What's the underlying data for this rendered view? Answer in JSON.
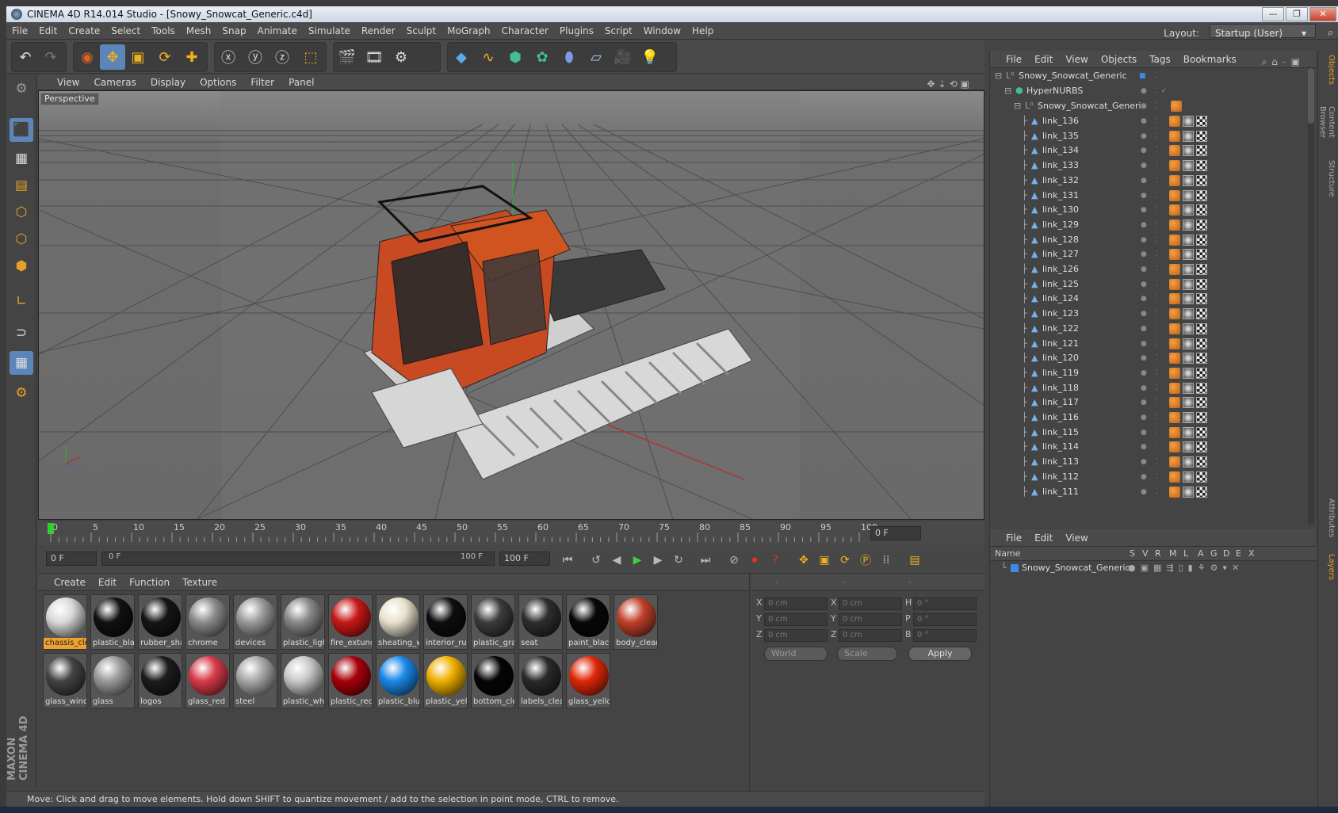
{
  "window": {
    "title": "CINEMA 4D R14.014 Studio - [Snowy_Snowcat_Generic.c4d]",
    "minimize": "—",
    "maximize": "❐",
    "close": "✕"
  },
  "menu": [
    "File",
    "Edit",
    "Create",
    "Select",
    "Tools",
    "Mesh",
    "Snap",
    "Animate",
    "Simulate",
    "Render",
    "Sculpt",
    "MoGraph",
    "Character",
    "Plugins",
    "Script",
    "Window",
    "Help"
  ],
  "layout": {
    "label": "Layout:",
    "value": "Startup (User)"
  },
  "viewport": {
    "menu": [
      "View",
      "Cameras",
      "Display",
      "Options",
      "Filter",
      "Panel"
    ],
    "label": "Perspective"
  },
  "timeline": {
    "ticks": [
      "0",
      "5",
      "10",
      "15",
      "20",
      "25",
      "30",
      "35",
      "40",
      "45",
      "50",
      "55",
      "60",
      "65",
      "70",
      "75",
      "80",
      "85",
      "90",
      "95",
      "100"
    ],
    "current_frame": "0 F"
  },
  "playback": {
    "start": "0 F",
    "range_start": "0 F",
    "range_end": "100 F",
    "end": "100 F"
  },
  "materials": {
    "menu": [
      "Create",
      "Edit",
      "Function",
      "Texture"
    ],
    "items": [
      {
        "name": "chassis_cle",
        "color": "#d8d8d8",
        "selected": true
      },
      {
        "name": "plastic_blac",
        "color": "#111111"
      },
      {
        "name": "rubber_sha",
        "color": "#151515"
      },
      {
        "name": "chrome",
        "color": "#8a8a8a"
      },
      {
        "name": "devices",
        "color": "#9a9a9a"
      },
      {
        "name": "plastic_ligh",
        "color": "#888888"
      },
      {
        "name": "fire_extung",
        "color": "#c81818"
      },
      {
        "name": "sheating_w",
        "color": "#e8e2cc"
      },
      {
        "name": "interior_rul",
        "color": "#0e0e0e"
      },
      {
        "name": "plastic_gra",
        "color": "#3c3c3c"
      },
      {
        "name": "seat",
        "color": "#2e2e2e"
      },
      {
        "name": "paint_black",
        "color": "#080808"
      },
      {
        "name": "body_clear",
        "color": "#c0402a"
      },
      {
        "name": "glass_wind",
        "color": "#444444"
      },
      {
        "name": "glass",
        "color": "#9a9a9a"
      },
      {
        "name": "logos",
        "color": "#1c1c1c"
      },
      {
        "name": "glass_red",
        "color": "#d83a4a"
      },
      {
        "name": "steel",
        "color": "#a8a8a8"
      },
      {
        "name": "plastic_whi",
        "color": "#c8c8c8"
      },
      {
        "name": "plastic_red",
        "color": "#a8000a"
      },
      {
        "name": "plastic_blu",
        "color": "#1a88e8"
      },
      {
        "name": "plastic_yell",
        "color": "#f0b000"
      },
      {
        "name": "bottom_cle",
        "color": "#050505"
      },
      {
        "name": "labels_clea",
        "color": "#2a2a2a"
      },
      {
        "name": "glass_yello",
        "color": "#e02808"
      }
    ]
  },
  "coords": {
    "headers": [
      "--",
      "--",
      "--"
    ],
    "rows": [
      {
        "l1": "X",
        "v1": "0 cm",
        "l2": "X",
        "v2": "0 cm",
        "l3": "H",
        "v3": "0 °"
      },
      {
        "l1": "Y",
        "v1": "0 cm",
        "l2": "Y",
        "v2": "0 cm",
        "l3": "P",
        "v3": "0 °"
      },
      {
        "l1": "Z",
        "v1": "0 cm",
        "l2": "Z",
        "v2": "0 cm",
        "l3": "B",
        "v3": "0 °"
      }
    ],
    "mode1": "World",
    "mode2": "Scale",
    "apply": "Apply"
  },
  "status": "Move: Click and drag to move elements. Hold down SHIFT to quantize movement / add to the selection in point mode, CTRL to remove.",
  "objects": {
    "menu": [
      "File",
      "Edit",
      "View",
      "Objects",
      "Tags",
      "Bookmarks"
    ],
    "root": "Snowy_Snowcat_Generic",
    "hypernurbs": "HyperNURBS",
    "group": "Snowy_Snowcat_Generic",
    "links": [
      "link_136",
      "link_135",
      "link_134",
      "link_133",
      "link_132",
      "link_131",
      "link_130",
      "link_129",
      "link_128",
      "link_127",
      "link_126",
      "link_125",
      "link_124",
      "link_123",
      "link_122",
      "link_121",
      "link_120",
      "link_119",
      "link_118",
      "link_117",
      "link_116",
      "link_115",
      "link_114",
      "link_113",
      "link_112",
      "link_111"
    ]
  },
  "layers": {
    "menu": [
      "File",
      "Edit",
      "View"
    ],
    "headers": [
      "Name",
      "S",
      "V",
      "R",
      "M",
      "L",
      "A",
      "G",
      "D",
      "E",
      "X"
    ],
    "row": "Snowy_Snowcat_Generic"
  },
  "sidetabs": [
    "Objects",
    "Content Browser",
    "Structure",
    "Attributes",
    "Layers"
  ],
  "branding": "MAXON CINEMA 4D",
  "colors": {
    "accent": "#5c86b8",
    "orange": "#e6a12a",
    "selected_material": "#f0a030"
  }
}
